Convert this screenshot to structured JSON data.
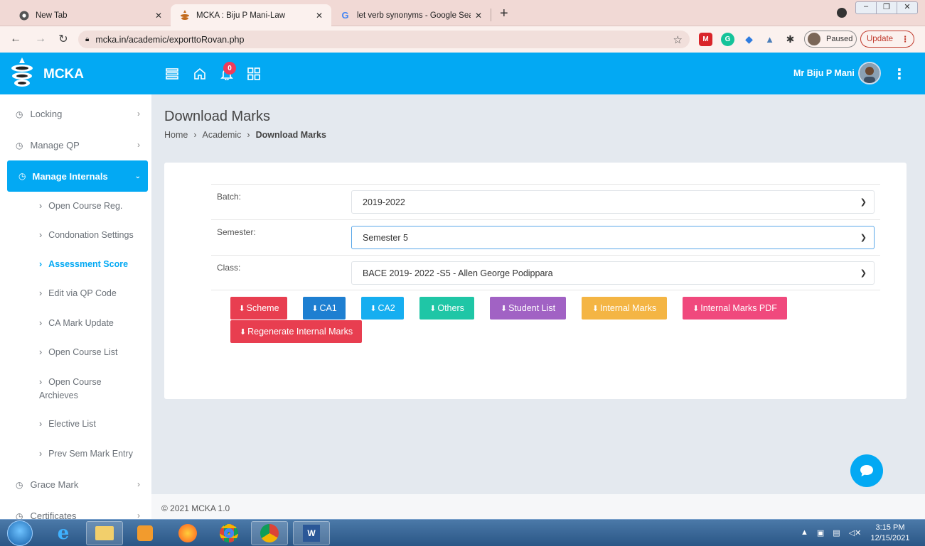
{
  "browser": {
    "tabs": [
      {
        "title": "New Tab",
        "active": false
      },
      {
        "title": "MCKA : Biju P Mani-Law",
        "active": true
      },
      {
        "title": "let verb synonyms - Google Sear",
        "active": false
      }
    ],
    "url": "mcka.in/academic/exporttoRovan.php",
    "paused_label": "Paused",
    "update_label": "Update"
  },
  "app": {
    "brand": "MCKA",
    "notification_count": "0",
    "user_name": "Mr Biju P Mani",
    "accent_color": "#03a9f3"
  },
  "sidebar": {
    "items_top": [
      {
        "label": "Locking"
      },
      {
        "label": "Manage QP"
      }
    ],
    "active": {
      "label": "Manage Internals"
    },
    "sub_items": [
      {
        "label": "Open Course Reg."
      },
      {
        "label": "Condonation Settings"
      },
      {
        "label": "Assessment Score",
        "current": true
      },
      {
        "label": "Edit via QP Code"
      },
      {
        "label": "CA Mark Update"
      },
      {
        "label": "Open Course List"
      },
      {
        "label": "Open Course Archieves"
      },
      {
        "label": "Elective List"
      },
      {
        "label": "Prev Sem Mark Entry"
      }
    ],
    "items_bottom": [
      {
        "label": "Grace Mark"
      },
      {
        "label": "Certificates"
      }
    ]
  },
  "page": {
    "title": "Download Marks",
    "breadcrumb": [
      "Home",
      "Academic",
      "Download Marks"
    ]
  },
  "form": {
    "batch": {
      "label": "Batch:",
      "value": "2019-2022"
    },
    "semester": {
      "label": "Semester:",
      "value": "Semester 5"
    },
    "class": {
      "label": "Class:",
      "value": "BACE 2019- 2022 -S5 - Allen George Podippara"
    }
  },
  "buttons": [
    {
      "label": "Scheme",
      "color": "#e83e50"
    },
    {
      "label": "CA1",
      "color": "#1e7fd1"
    },
    {
      "label": "CA2",
      "color": "#16aef0"
    },
    {
      "label": "Others",
      "color": "#1fc6a6"
    },
    {
      "label": "Student List",
      "color": "#a162c4"
    },
    {
      "label": "Internal Marks",
      "color": "#f4b544"
    },
    {
      "label": "Internal Marks PDF",
      "color": "#f0497d"
    },
    {
      "label": "Regenerate Internal Marks",
      "color": "#e83e50"
    }
  ],
  "footer": {
    "text": "© 2021 MCKA 1.0"
  },
  "taskbar": {
    "time": "3:15 PM",
    "date": "12/15/2021"
  }
}
